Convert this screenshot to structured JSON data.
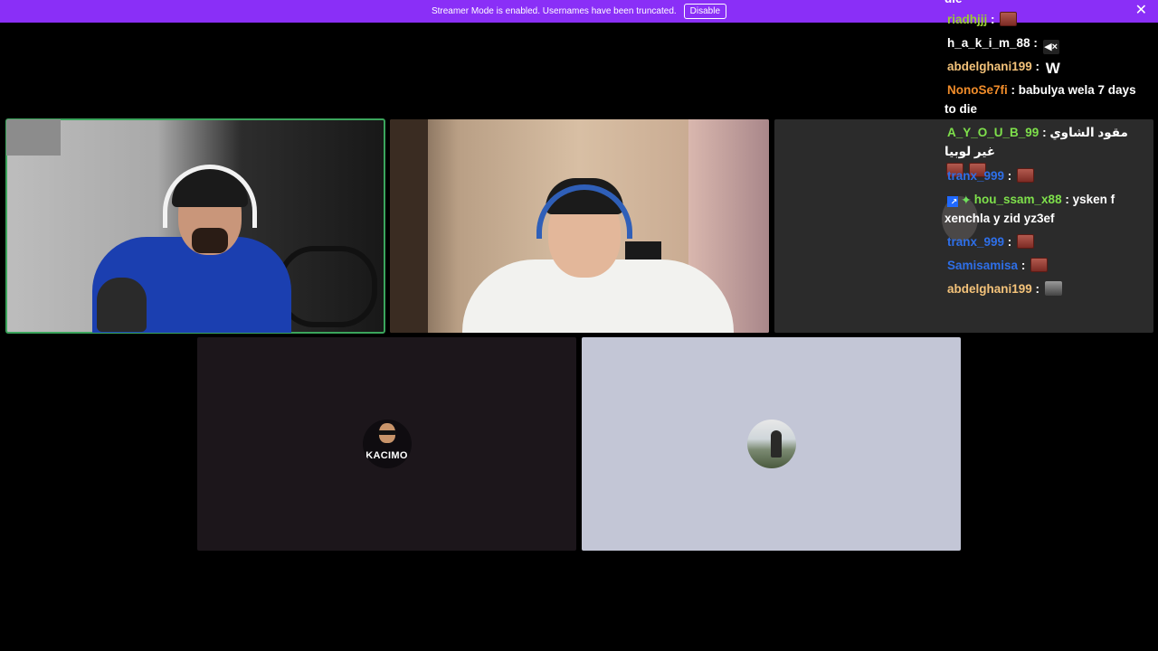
{
  "banner": {
    "text": "Streamer Mode is enabled. Usernames have been truncated.",
    "disable_label": "Disable",
    "close_glyph": "✕"
  },
  "tiles": [
    {
      "name": "participant-1",
      "active": true
    },
    {
      "name": "participant-2",
      "active": false
    },
    {
      "name": "participant-3",
      "active": false
    },
    {
      "name": "participant-kacimo",
      "avatar_text": "KACIMO"
    },
    {
      "name": "participant-5"
    }
  ],
  "chat": {
    "top_fragment": "die",
    "messages": [
      {
        "user": "riadhjjj",
        "color": "#9acd32",
        "text": "",
        "emotes": [
          "red"
        ]
      },
      {
        "user": "h_a_k_i_m_88",
        "color": "#ffffff",
        "text": "",
        "emotes": [
          "mute"
        ]
      },
      {
        "user": "abdelghani199",
        "color": "#f4c37a",
        "text": "",
        "emotes": [
          "w"
        ]
      },
      {
        "user": "NonoSe7fi",
        "color": "#f08c2a",
        "text": "babulya wela 7 days to die"
      },
      {
        "user": "A_Y_O_U_B_99",
        "color": "#7ee04b",
        "text": "مقود الشاوي غير لوبيا",
        "emotes": [
          "red",
          "red"
        ]
      },
      {
        "user": "tranx_999",
        "color": "#2e6fe8",
        "text": "",
        "emotes": [
          "red"
        ]
      },
      {
        "user": "hou_ssam_x88",
        "color": "#7ee04b",
        "text": "ysken f xenchla y zid yz3ef",
        "badges": [
          "blue",
          "green"
        ]
      },
      {
        "user": "tranx_999",
        "color": "#2e6fe8",
        "text": "",
        "emotes": [
          "red"
        ]
      },
      {
        "user": "Samisamisa",
        "color": "#2e6fe8",
        "text": "",
        "emotes": [
          "red"
        ]
      },
      {
        "user": "abdelghani199",
        "color": "#f4c37a",
        "text": "",
        "emotes": [
          "gray"
        ]
      }
    ],
    "separator": " : ",
    "w_glyph": "W",
    "mute_glyph": "◀×",
    "badge_blue_glyph": "↗",
    "badge_green_glyph": "✦"
  }
}
